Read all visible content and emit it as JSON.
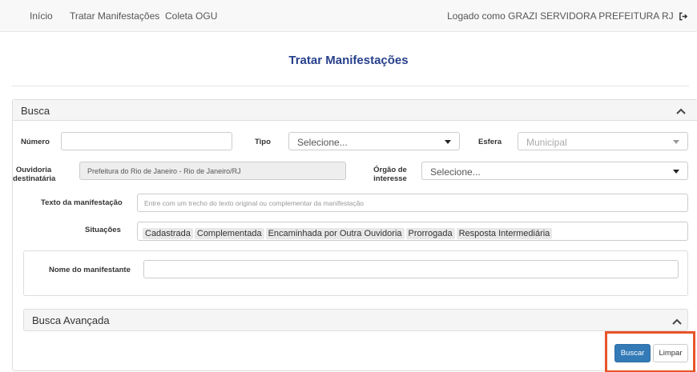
{
  "nav": {
    "items": [
      "Início",
      "Tratar Manifestações",
      "Coleta OGU"
    ],
    "user_text": "Logado como GRAZI SERVIDORA PREFEITURA RJ"
  },
  "page": {
    "title": "Tratar Manifestações"
  },
  "busca": {
    "title": "Busca",
    "numero": {
      "label": "Número",
      "value": ""
    },
    "tipo": {
      "label": "Tipo",
      "value": "Selecione..."
    },
    "esfera": {
      "label": "Esfera",
      "value": "Municipal"
    },
    "ouvidoria": {
      "label_1": "Ouvidoria",
      "label_2": "destinatária",
      "value": "Prefeitura do Rio de Janeiro - Rio de Janeiro/RJ"
    },
    "orgao": {
      "label_1": "Órgão de",
      "label_2": "interesse",
      "value": "Selecione..."
    },
    "texto": {
      "label": "Texto da manifestação",
      "placeholder": "Entre com um trecho do texto original ou complementar da manifestação"
    },
    "situacoes": {
      "label": "Situações",
      "tags": [
        "Cadastrada",
        "Complementada",
        "Encaminhada por Outra Ouvidoria",
        "Prorrogada",
        "Resposta Intermediária"
      ]
    },
    "nome": {
      "label": "Nome do manifestante",
      "value": ""
    }
  },
  "busca_avancada": {
    "title": "Busca Avançada"
  },
  "actions": {
    "buscar": "Buscar",
    "limpar": "Limpar"
  },
  "colors": {
    "title": "#27408b",
    "primary": "#337ab7",
    "highlight": "#e8542a"
  }
}
